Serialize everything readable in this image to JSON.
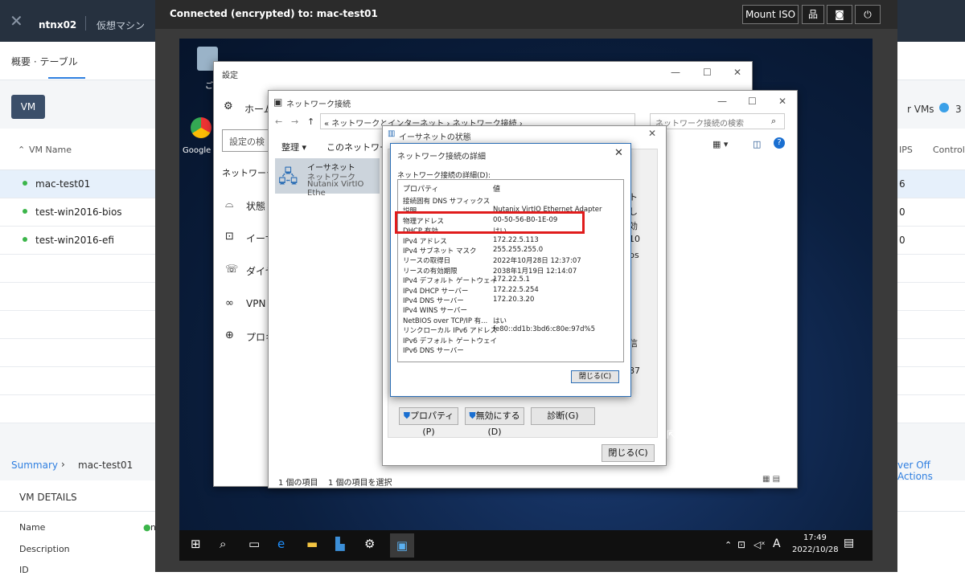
{
  "prism": {
    "cluster": "ntnx02",
    "nav": "仮想マシン",
    "subtabs": "概要 · テーブル",
    "vm_button": "VM",
    "col_vm_name": "VM Name",
    "col_ips": "IPS",
    "col_controller": "Control",
    "right_header": "r VMs",
    "right_header_count": "3",
    "rows": [
      {
        "name": "mac-test01",
        "val": "6"
      },
      {
        "name": "test-win2016-bios",
        "val": "0"
      },
      {
        "name": "test-win2016-efi",
        "val": "0"
      }
    ],
    "summary": "Summary",
    "summary_vm": "mac-test01",
    "power_off": "ver Off Actions",
    "vm_details": "VM DETAILS",
    "name_label": "Name",
    "name_value": "n",
    "description_label": "Description",
    "id_label": "ID"
  },
  "console": {
    "connection": "Connected (encrypted) to: mac-test01",
    "mount_iso": "Mount ISO"
  },
  "desktop": {
    "icon_google": "Google",
    "icon_recycle": "ご"
  },
  "settings": {
    "title": "設定",
    "home": "ホーム",
    "search_placeholder": "設定の検",
    "section": "ネットワークと",
    "items": [
      "状態",
      "イーサ",
      "ダイヤ",
      "VPN",
      "プロキ"
    ]
  },
  "netconn": {
    "title": "ネットワーク接続",
    "breadcrumb": "« ネットワークとインターネット › ネットワーク接続 ›",
    "search_placeholder": "ネットワーク接続の検索",
    "organize": "整理 ▾",
    "this_network": "このネットワーク デ",
    "adapter_name": "イーサネット",
    "adapter_net": "ネットワーク",
    "adapter_dev": "Nutanix VirtIO Ethe",
    "status_items": "1 個の項目",
    "status_selected": "1 個の項目を選択"
  },
  "ethstatus": {
    "title": "イーサネットの状態",
    "properties_btn": "プロパティ(P)",
    "disable_btn": "無効にする(D)",
    "diagnose_btn": "診断(G)",
    "close_btn": "閉じる(C)",
    "side_texts": [
      "ト",
      "し",
      "効",
      "10",
      "ps",
      "信",
      "87"
    ]
  },
  "details": {
    "title": "ネットワーク接続の詳細",
    "label": "ネットワーク接続の詳細(D):",
    "col_property": "プロパティ",
    "col_value": "値",
    "rows": [
      {
        "p": "接続固有 DNS サフィックス",
        "v": ""
      },
      {
        "p": "説明",
        "v": "Nutanix VirtIO Ethernet Adapter"
      },
      {
        "p": "物理アドレス",
        "v": "00-50-56-B0-1E-09"
      },
      {
        "p": "DHCP 有効",
        "v": "はい"
      },
      {
        "p": "IPv4 アドレス",
        "v": "172.22.5.113"
      },
      {
        "p": "IPv4 サブネット マスク",
        "v": "255.255.255.0"
      },
      {
        "p": "リースの取得日",
        "v": "2022年10月28日 12:37:07"
      },
      {
        "p": "リースの有効期限",
        "v": "2038年1月19日 12:14:07"
      },
      {
        "p": "IPv4 デフォルト ゲートウェイ",
        "v": "172.22.5.1"
      },
      {
        "p": "IPv4 DHCP サーバー",
        "v": "172.22.5.254"
      },
      {
        "p": "IPv4 DNS サーバー",
        "v": "172.20.3.20"
      },
      {
        "p": "IPv4 WINS サーバー",
        "v": ""
      },
      {
        "p": "NetBIOS over TCP/IP 有...",
        "v": "はい"
      },
      {
        "p": "リンクローカル IPv6 アドレス",
        "v": "fe80::dd1b:3bd6:c80e:97d%5"
      },
      {
        "p": "IPv6 デフォルト ゲートウェイ",
        "v": ""
      },
      {
        "p": "IPv6 DNS サーバー",
        "v": ""
      }
    ],
    "close_btn": "閉じる(C)"
  },
  "taskbar": {
    "time": "17:49",
    "date": "2022/10/28",
    "ime": "A"
  }
}
